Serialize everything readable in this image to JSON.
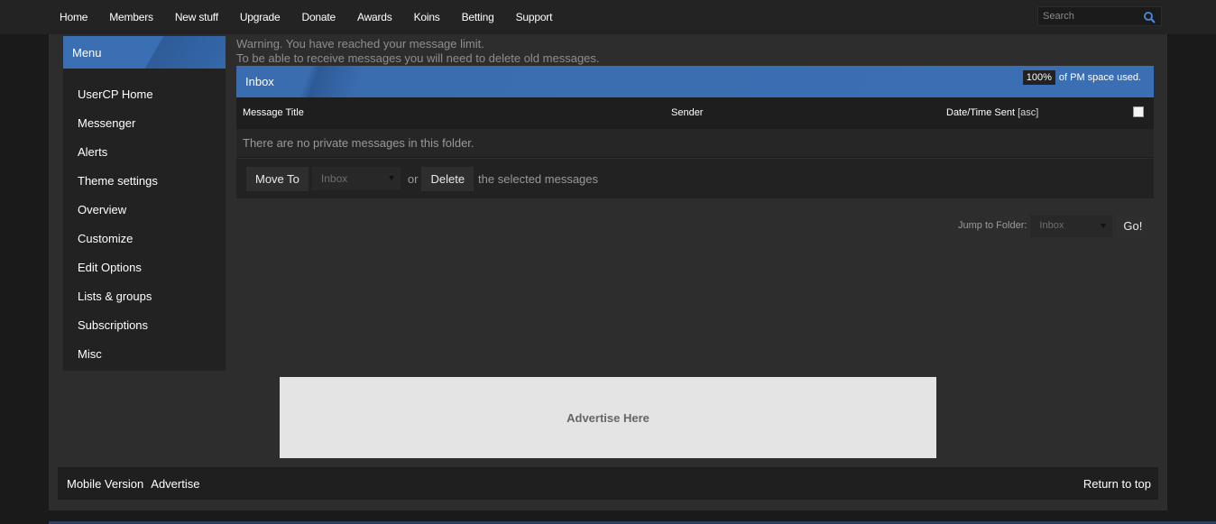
{
  "nav": {
    "items": [
      {
        "label": "Home"
      },
      {
        "label": "Members"
      },
      {
        "label": "New stuff"
      },
      {
        "label": "Upgrade"
      },
      {
        "label": "Donate"
      },
      {
        "label": "Awards"
      },
      {
        "label": "Koins"
      },
      {
        "label": "Betting"
      },
      {
        "label": "Support"
      }
    ],
    "search_placeholder": "Search",
    "search_icon": "search-icon",
    "accent": "#3b6fb3"
  },
  "sidebar": {
    "title": "Menu",
    "items": [
      {
        "label": "UserCP Home"
      },
      {
        "label": "Messenger"
      },
      {
        "label": "Alerts"
      },
      {
        "label": "Theme settings"
      },
      {
        "label": "Overview"
      },
      {
        "label": "Customize"
      },
      {
        "label": "Edit Options"
      },
      {
        "label": "Lists & groups"
      },
      {
        "label": "Subscriptions"
      },
      {
        "label": "Misc"
      }
    ]
  },
  "warning": {
    "line1": "Warning. You have reached your message limit.",
    "line2": "To be able to receive messages you will need to delete old messages."
  },
  "inbox": {
    "title": "Inbox",
    "pm_percent": "100%",
    "pm_text": "of PM space used.",
    "columns": {
      "title": "Message Title",
      "sender": "Sender",
      "date": "Date/Time Sent",
      "sort": "[asc]"
    },
    "empty_text": "There are no private messages in this folder.",
    "actions": {
      "move_to": "Move To",
      "folder_selected": "Inbox",
      "or": "or",
      "delete": "Delete",
      "tail": "the selected messages"
    },
    "jump": {
      "label": "Jump to Folder:",
      "selected": "Inbox",
      "go": "Go!"
    }
  },
  "ad": {
    "text": "Advertise Here"
  },
  "footer": {
    "mobile": "Mobile Version",
    "advertise": "Advertise",
    "top": "Return to top"
  }
}
